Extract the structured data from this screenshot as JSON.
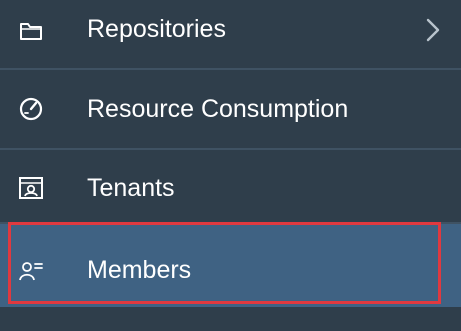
{
  "sidebar": {
    "items": [
      {
        "label": "Repositories",
        "icon": "folder-icon",
        "has_submenu": true
      },
      {
        "label": "Resource Consumption",
        "icon": "gauge-icon",
        "has_submenu": false
      },
      {
        "label": "Tenants",
        "icon": "tenants-icon",
        "has_submenu": false
      },
      {
        "label": "Members",
        "icon": "members-icon",
        "has_submenu": false,
        "selected": true
      }
    ],
    "highlighted_item": "Members"
  },
  "colors": {
    "sidebar_bg": "#2f3e4b",
    "selected_bg": "#3f6283",
    "highlight_border": "#e0393f",
    "text": "#ffffff"
  }
}
